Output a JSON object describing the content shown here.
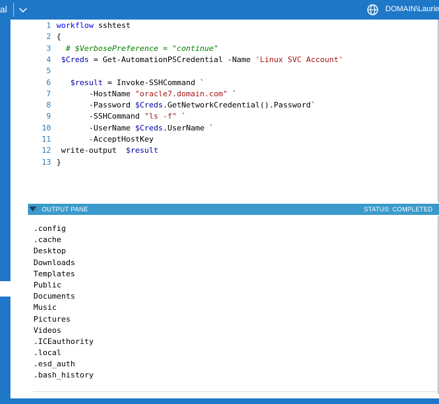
{
  "topbar": {
    "left_fragment": "al",
    "user_label": "DOMAIN\\Laurie",
    "icons": [
      "chevron-down-icon",
      "globe-icon"
    ]
  },
  "editor": {
    "lines": [
      {
        "n": "1",
        "tokens": [
          {
            "t": "workflow",
            "c": "kw"
          },
          {
            "t": " sshtest",
            "c": ""
          }
        ]
      },
      {
        "n": "2",
        "tokens": [
          {
            "t": "{",
            "c": ""
          }
        ]
      },
      {
        "n": "3",
        "tokens": [
          {
            "t": "  # $VerbosePreference = \"continue\"",
            "c": "cm"
          }
        ]
      },
      {
        "n": "4",
        "tokens": [
          {
            "t": " ",
            "c": ""
          },
          {
            "t": "$Creds",
            "c": "var"
          },
          {
            "t": " = Get-AutomationPSCredential -Name ",
            "c": ""
          },
          {
            "t": "'Linux SVC Account'",
            "c": "str"
          }
        ]
      },
      {
        "n": "5",
        "tokens": []
      },
      {
        "n": "6",
        "tokens": [
          {
            "t": "   ",
            "c": ""
          },
          {
            "t": "$result",
            "c": "var"
          },
          {
            "t": " = Invoke-SSHCommand `",
            "c": ""
          }
        ]
      },
      {
        "n": "7",
        "tokens": [
          {
            "t": "       -HostName ",
            "c": ""
          },
          {
            "t": "\"oracle7.domain.com\"",
            "c": "str"
          },
          {
            "t": " `",
            "c": ""
          }
        ]
      },
      {
        "n": "8",
        "tokens": [
          {
            "t": "       -Password ",
            "c": ""
          },
          {
            "t": "$Creds",
            "c": "var"
          },
          {
            "t": ".GetNetworkCredential().Password`",
            "c": ""
          }
        ]
      },
      {
        "n": "9",
        "tokens": [
          {
            "t": "       -SSHCommand ",
            "c": ""
          },
          {
            "t": "\"ls -f\"",
            "c": "str"
          },
          {
            "t": " `",
            "c": ""
          }
        ]
      },
      {
        "n": "10",
        "tokens": [
          {
            "t": "       -UserName ",
            "c": ""
          },
          {
            "t": "$Creds",
            "c": "var"
          },
          {
            "t": ".UserName `",
            "c": ""
          }
        ]
      },
      {
        "n": "11",
        "tokens": [
          {
            "t": "       -AcceptHostKey",
            "c": ""
          }
        ]
      },
      {
        "n": "12",
        "tokens": [
          {
            "t": " write-output  ",
            "c": ""
          },
          {
            "t": "$result",
            "c": "var"
          }
        ]
      },
      {
        "n": "13",
        "tokens": [
          {
            "t": "}",
            "c": ""
          }
        ]
      }
    ],
    "colors": {
      "keyword": "#0000ff",
      "comment": "#008000",
      "variable": "#0000a8",
      "string": "#a31515",
      "line_number": "#2b7bb9"
    }
  },
  "output_pane": {
    "title": "OUTPUT PANE",
    "status": "STATUS: COMPLETED",
    "icon": "triangle-down-icon",
    "items": [
      ".config",
      ".cache",
      "Desktop",
      "Downloads",
      "Templates",
      "Public",
      "Documents",
      "Music",
      "Pictures",
      "Videos",
      ".ICEauthority",
      ".local",
      ".esd_auth",
      ".bash_history"
    ]
  },
  "colors": {
    "accent": "#1f77c7",
    "output_header": "#3b9acb"
  }
}
